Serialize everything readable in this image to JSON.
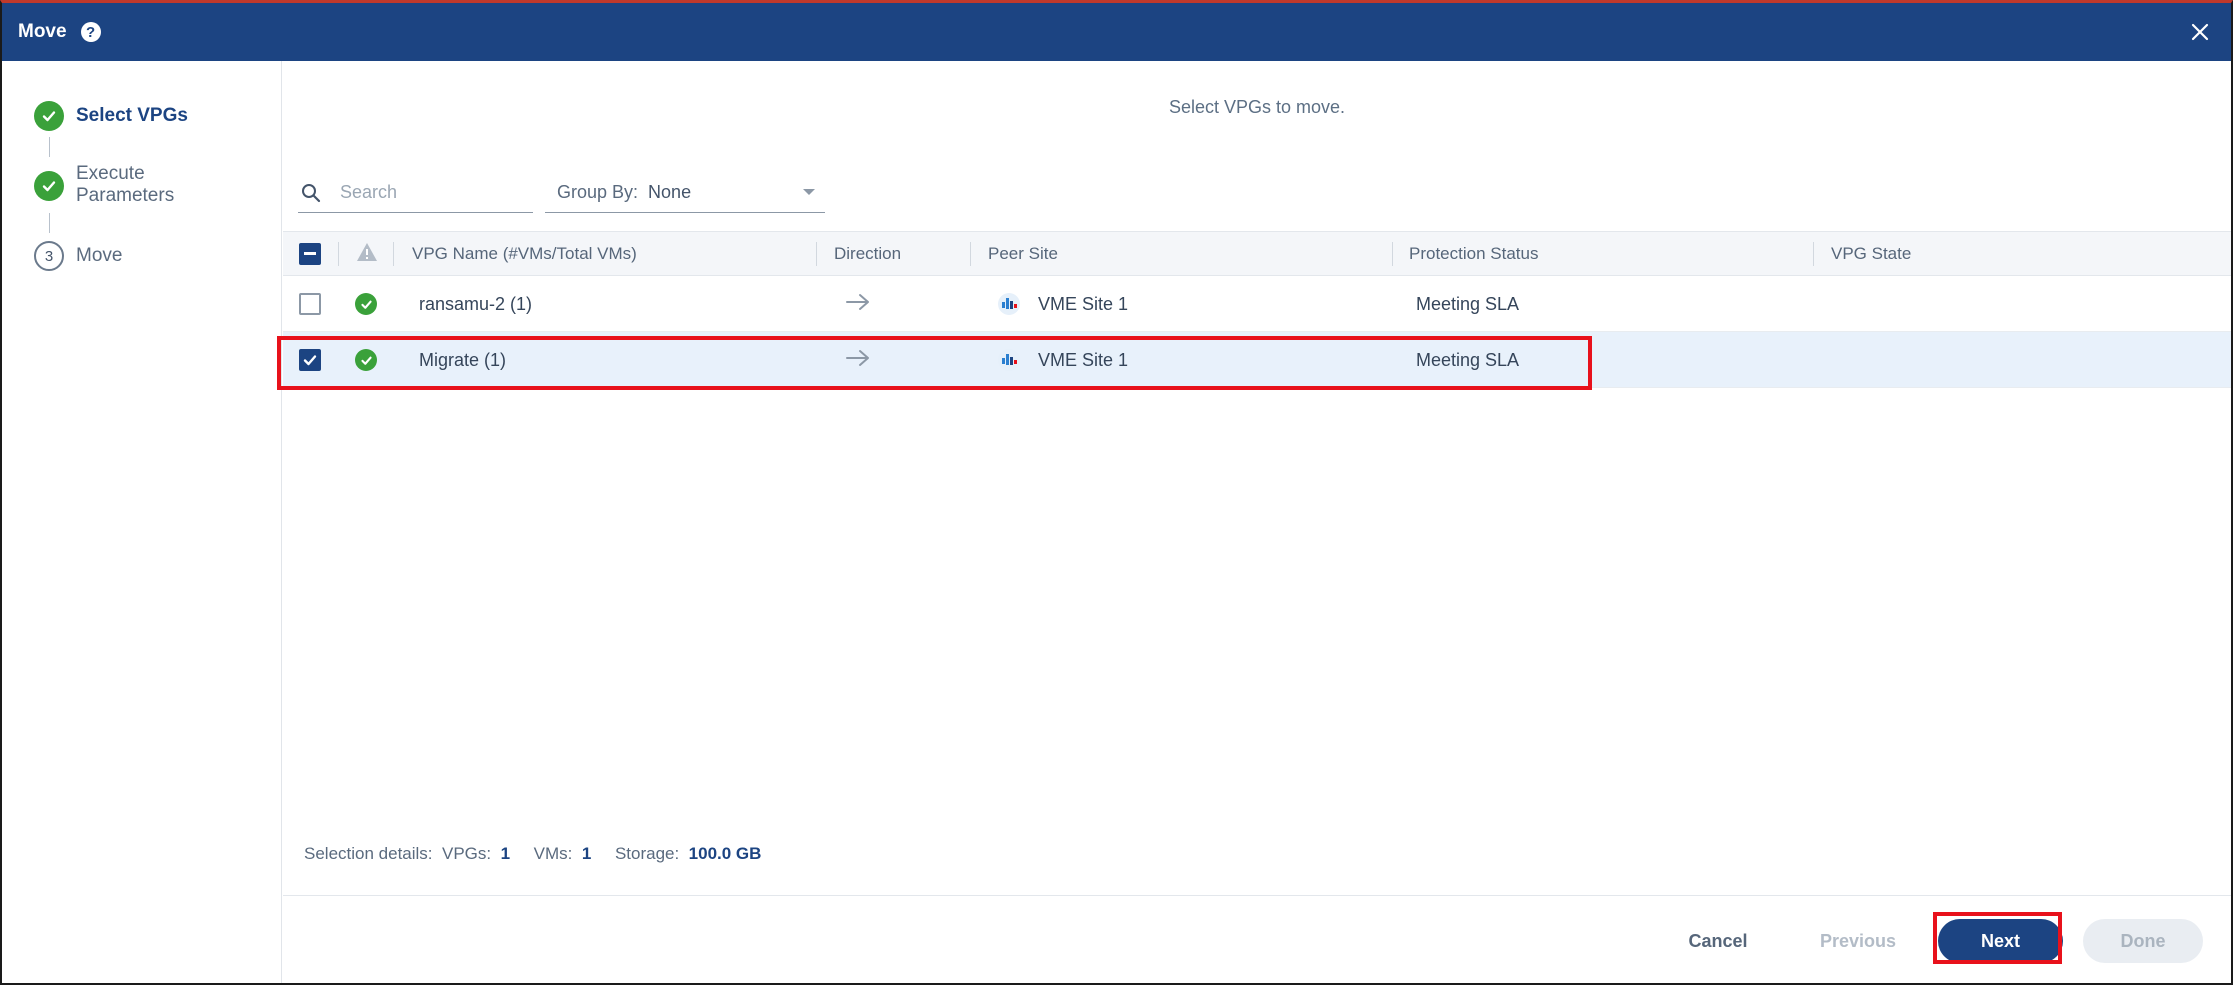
{
  "window": {
    "title": "Move",
    "help_icon": "help-circle-icon",
    "close_icon": "close-icon"
  },
  "wizard": {
    "steps": [
      {
        "label": "Select VPGs",
        "state": "complete",
        "active": true
      },
      {
        "label": "Execute Parameters",
        "line1": "Execute",
        "line2": "Parameters",
        "state": "complete",
        "active": false
      },
      {
        "label": "Move",
        "number": "3",
        "state": "pending",
        "active": false
      }
    ]
  },
  "main": {
    "instruction": "Select VPGs to move."
  },
  "search": {
    "placeholder": "Search",
    "value": ""
  },
  "group_by": {
    "label": "Group By:",
    "value": "None"
  },
  "table": {
    "columns": {
      "vpg_name": "VPG Name (#VMs/Total VMs)",
      "direction": "Direction",
      "peer_site": "Peer Site",
      "protection_status": "Protection Status",
      "vpg_state": "VPG State"
    },
    "rows": [
      {
        "selected": false,
        "name": "ransamu-2 (1)",
        "direction": "→",
        "peer_site": "VME Site 1",
        "protection_status": "Meeting SLA",
        "vpg_state": ""
      },
      {
        "selected": true,
        "name": "Migrate (1)",
        "direction": "→",
        "peer_site": "VME Site 1",
        "protection_status": "Meeting SLA",
        "vpg_state": ""
      }
    ]
  },
  "selection_details": {
    "label": "Selection details:",
    "vpgs_label": "VPGs:",
    "vpgs_value": "1",
    "vms_label": "VMs:",
    "vms_value": "1",
    "storage_label": "Storage:",
    "storage_value": "100.0 GB"
  },
  "buttons": {
    "cancel": "Cancel",
    "previous": "Previous",
    "next": "Next",
    "done": "Done"
  },
  "colors": {
    "header_blue": "#1c4482",
    "success_green": "#3aa13a",
    "highlight_red": "#e8111b",
    "selected_row": "#e8f1fb"
  }
}
